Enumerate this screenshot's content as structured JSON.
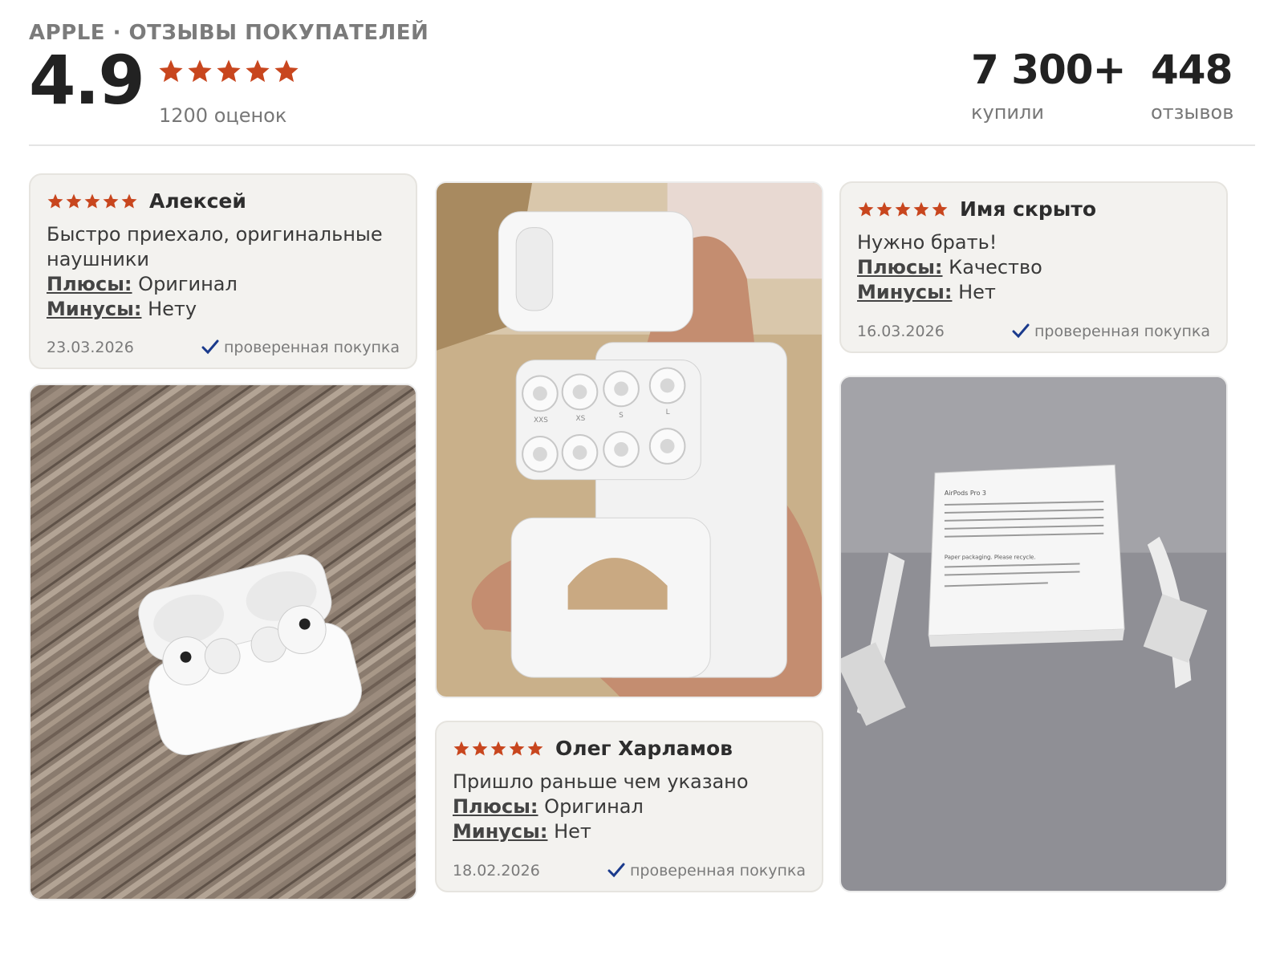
{
  "header": {
    "brand": "APPLE · ОТЗЫВЫ ПОКУПАТЕЛЕЙ",
    "rating": "4.9",
    "stars": 5,
    "ratings_count": "1200 оценок",
    "bought_value": "7 300+",
    "bought_label": "купили",
    "reviews_value": "448",
    "reviews_label": "отзывов"
  },
  "colors": {
    "star": "#c8461e",
    "check": "#1a3a8c"
  },
  "reviews": [
    {
      "name": "Алексей",
      "stars": 5,
      "text": "Быстро приехало, оригинальные наушники",
      "pros_label": "Плюсы:",
      "pros": "Оригинал",
      "cons_label": "Минусы:",
      "cons": "Нету",
      "date": "23.03.2026",
      "verified": "проверенная покупка"
    },
    {
      "name": "Имя скрыто",
      "stars": 5,
      "text": "Нужно брать!",
      "pros_label": "Плюсы:",
      "pros": "Качество",
      "cons_label": "Минусы:",
      "cons": "Нет",
      "date": "16.03.2026",
      "verified": "проверенная покупка"
    },
    {
      "name": "Олег Харламов",
      "stars": 5,
      "text": "Пришло раньше чем указано",
      "pros_label": "Плюсы:",
      "pros": "Оригинал",
      "cons_label": "Минусы:",
      "cons": "Нет",
      "date": "18.02.2026",
      "verified": "проверенная покупка"
    }
  ],
  "photos": [
    {
      "subject": "airpods-case-on-wood-table"
    },
    {
      "subject": "hand-holding-ear-tips-pack"
    },
    {
      "subject": "airpods-box-on-gray-table"
    }
  ],
  "photo_labels": {
    "tip_sizes": [
      "XXS",
      "XS",
      "S",
      "L"
    ],
    "box_title": "AirPods Pro 3",
    "box_recycle": "Paper packaging. Please recycle."
  }
}
